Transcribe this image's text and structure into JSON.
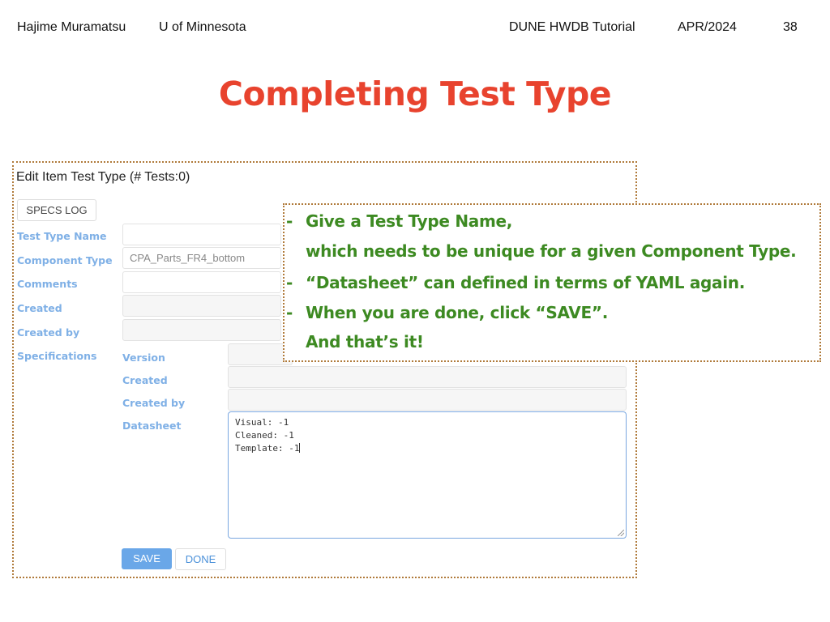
{
  "header": {
    "author": "Hajime Muramatsu",
    "institution": "U of Minnesota",
    "talk": "DUNE HWDB Tutorial",
    "date": "APR/2024",
    "page": "38"
  },
  "slide": {
    "title": "Completing Test Type"
  },
  "form": {
    "title": "Edit Item Test Type (# Tests:0)",
    "specs_log_button": "SPECS LOG",
    "labels": {
      "test_type_name": "Test Type Name",
      "component_type": "Component Type",
      "comments": "Comments",
      "created": "Created",
      "created_by": "Created by",
      "specifications": "Specifications"
    },
    "values": {
      "test_type_name": "",
      "component_type": "CPA_Parts_FR4_bottom",
      "comments": "",
      "created": "",
      "created_by": ""
    },
    "specs": {
      "labels": {
        "version": "Version",
        "created": "Created",
        "created_by": "Created by",
        "datasheet": "Datasheet"
      },
      "values": {
        "version": "",
        "created": "",
        "created_by": ""
      },
      "datasheet_lines": [
        "Visual: -1",
        "Cleaned: -1",
        "Template: -1"
      ]
    },
    "save_button": "SAVE",
    "done_button": "DONE"
  },
  "callout": {
    "dash": "-",
    "lines": [
      "Give a Test Type Name,",
      "which needs to be unique for a given Component Type.",
      "“Datasheet” can defined in terms of YAML again.",
      "When you are done, click “SAVE”.",
      "And that’s it!"
    ]
  },
  "colors": {
    "title": "#e8432e",
    "label": "#7fb0e6",
    "callout_text": "#3d8a22",
    "border_dotted": "#b07a3a",
    "save_bg": "#6aa7e8"
  }
}
